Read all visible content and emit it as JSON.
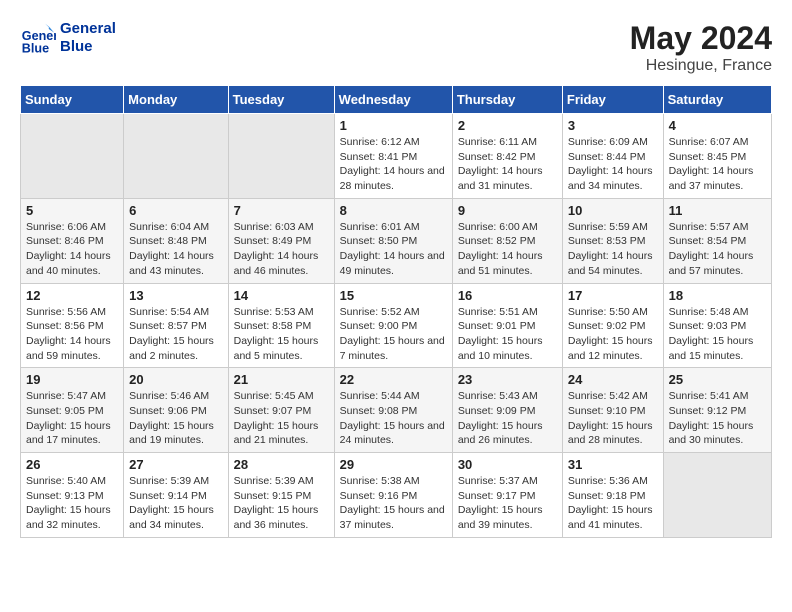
{
  "header": {
    "logo_line1": "General",
    "logo_line2": "Blue",
    "title": "May 2024",
    "subtitle": "Hesingue, France"
  },
  "days_of_week": [
    "Sunday",
    "Monday",
    "Tuesday",
    "Wednesday",
    "Thursday",
    "Friday",
    "Saturday"
  ],
  "weeks": [
    [
      {
        "day": "",
        "empty": true
      },
      {
        "day": "",
        "empty": true
      },
      {
        "day": "",
        "empty": true
      },
      {
        "day": "1",
        "sunrise": "6:12 AM",
        "sunset": "8:41 PM",
        "daylight": "14 hours and 28 minutes."
      },
      {
        "day": "2",
        "sunrise": "6:11 AM",
        "sunset": "8:42 PM",
        "daylight": "14 hours and 31 minutes."
      },
      {
        "day": "3",
        "sunrise": "6:09 AM",
        "sunset": "8:44 PM",
        "daylight": "14 hours and 34 minutes."
      },
      {
        "day": "4",
        "sunrise": "6:07 AM",
        "sunset": "8:45 PM",
        "daylight": "14 hours and 37 minutes."
      }
    ],
    [
      {
        "day": "5",
        "sunrise": "6:06 AM",
        "sunset": "8:46 PM",
        "daylight": "14 hours and 40 minutes."
      },
      {
        "day": "6",
        "sunrise": "6:04 AM",
        "sunset": "8:48 PM",
        "daylight": "14 hours and 43 minutes."
      },
      {
        "day": "7",
        "sunrise": "6:03 AM",
        "sunset": "8:49 PM",
        "daylight": "14 hours and 46 minutes."
      },
      {
        "day": "8",
        "sunrise": "6:01 AM",
        "sunset": "8:50 PM",
        "daylight": "14 hours and 49 minutes."
      },
      {
        "day": "9",
        "sunrise": "6:00 AM",
        "sunset": "8:52 PM",
        "daylight": "14 hours and 51 minutes."
      },
      {
        "day": "10",
        "sunrise": "5:59 AM",
        "sunset": "8:53 PM",
        "daylight": "14 hours and 54 minutes."
      },
      {
        "day": "11",
        "sunrise": "5:57 AM",
        "sunset": "8:54 PM",
        "daylight": "14 hours and 57 minutes."
      }
    ],
    [
      {
        "day": "12",
        "sunrise": "5:56 AM",
        "sunset": "8:56 PM",
        "daylight": "14 hours and 59 minutes."
      },
      {
        "day": "13",
        "sunrise": "5:54 AM",
        "sunset": "8:57 PM",
        "daylight": "15 hours and 2 minutes."
      },
      {
        "day": "14",
        "sunrise": "5:53 AM",
        "sunset": "8:58 PM",
        "daylight": "15 hours and 5 minutes."
      },
      {
        "day": "15",
        "sunrise": "5:52 AM",
        "sunset": "9:00 PM",
        "daylight": "15 hours and 7 minutes."
      },
      {
        "day": "16",
        "sunrise": "5:51 AM",
        "sunset": "9:01 PM",
        "daylight": "15 hours and 10 minutes."
      },
      {
        "day": "17",
        "sunrise": "5:50 AM",
        "sunset": "9:02 PM",
        "daylight": "15 hours and 12 minutes."
      },
      {
        "day": "18",
        "sunrise": "5:48 AM",
        "sunset": "9:03 PM",
        "daylight": "15 hours and 15 minutes."
      }
    ],
    [
      {
        "day": "19",
        "sunrise": "5:47 AM",
        "sunset": "9:05 PM",
        "daylight": "15 hours and 17 minutes."
      },
      {
        "day": "20",
        "sunrise": "5:46 AM",
        "sunset": "9:06 PM",
        "daylight": "15 hours and 19 minutes."
      },
      {
        "day": "21",
        "sunrise": "5:45 AM",
        "sunset": "9:07 PM",
        "daylight": "15 hours and 21 minutes."
      },
      {
        "day": "22",
        "sunrise": "5:44 AM",
        "sunset": "9:08 PM",
        "daylight": "15 hours and 24 minutes."
      },
      {
        "day": "23",
        "sunrise": "5:43 AM",
        "sunset": "9:09 PM",
        "daylight": "15 hours and 26 minutes."
      },
      {
        "day": "24",
        "sunrise": "5:42 AM",
        "sunset": "9:10 PM",
        "daylight": "15 hours and 28 minutes."
      },
      {
        "day": "25",
        "sunrise": "5:41 AM",
        "sunset": "9:12 PM",
        "daylight": "15 hours and 30 minutes."
      }
    ],
    [
      {
        "day": "26",
        "sunrise": "5:40 AM",
        "sunset": "9:13 PM",
        "daylight": "15 hours and 32 minutes."
      },
      {
        "day": "27",
        "sunrise": "5:39 AM",
        "sunset": "9:14 PM",
        "daylight": "15 hours and 34 minutes."
      },
      {
        "day": "28",
        "sunrise": "5:39 AM",
        "sunset": "9:15 PM",
        "daylight": "15 hours and 36 minutes."
      },
      {
        "day": "29",
        "sunrise": "5:38 AM",
        "sunset": "9:16 PM",
        "daylight": "15 hours and 37 minutes."
      },
      {
        "day": "30",
        "sunrise": "5:37 AM",
        "sunset": "9:17 PM",
        "daylight": "15 hours and 39 minutes."
      },
      {
        "day": "31",
        "sunrise": "5:36 AM",
        "sunset": "9:18 PM",
        "daylight": "15 hours and 41 minutes."
      },
      {
        "day": "",
        "empty": true
      }
    ]
  ],
  "labels": {
    "sunrise_prefix": "Sunrise: ",
    "sunset_prefix": "Sunset: ",
    "daylight_prefix": "Daylight: "
  }
}
